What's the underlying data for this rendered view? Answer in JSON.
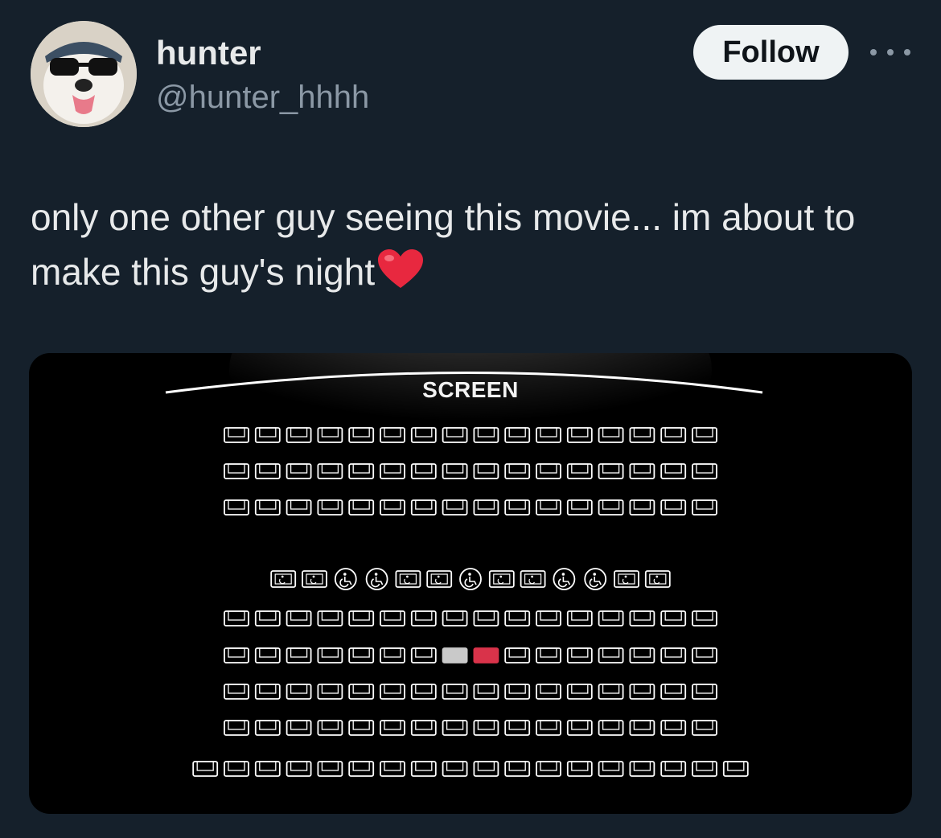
{
  "tweet": {
    "display_name": "hunter",
    "handle": "@hunter_hhhh",
    "follow_label": "Follow",
    "text": "only one other guy seeing this movie... im about to make this guy's night"
  },
  "seat_map": {
    "screen_label": "SCREEN",
    "rows": [
      "1111111111111111",
      "1111111111111111",
      "1111111111111111",
      "",
      "AAWWAAWAAWWAA",
      "1111111111111111",
      "1111111GR1111111",
      "1111111111111111",
      "1111111111111111",
      "111111111111111111"
    ],
    "legend": {
      "1": "available-seat",
      "A": "accessible-companion-seat",
      "W": "wheelchair-space",
      "G": "taken-seat",
      "R": "selected-seat"
    },
    "colors": {
      "available": "#ffffff",
      "taken": "#c9c9c9",
      "selected": "#d9334a"
    }
  }
}
